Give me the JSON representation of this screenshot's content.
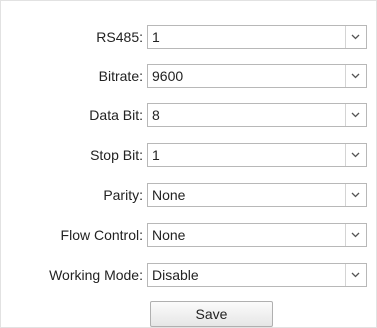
{
  "form": {
    "fields": [
      {
        "label": "RS485:",
        "value": "1"
      },
      {
        "label": "Bitrate:",
        "value": "9600"
      },
      {
        "label": "Data Bit:",
        "value": "8"
      },
      {
        "label": "Stop Bit:",
        "value": "1"
      },
      {
        "label": "Parity:",
        "value": "None"
      },
      {
        "label": "Flow Control:",
        "value": "None"
      },
      {
        "label": "Working Mode:",
        "value": "Disable"
      }
    ],
    "save_label": "Save"
  },
  "icons": {
    "dropdown": "chevron-down-icon"
  },
  "colors": {
    "border": "#b8b8b8",
    "background": "#ffffff",
    "text": "#222222"
  }
}
